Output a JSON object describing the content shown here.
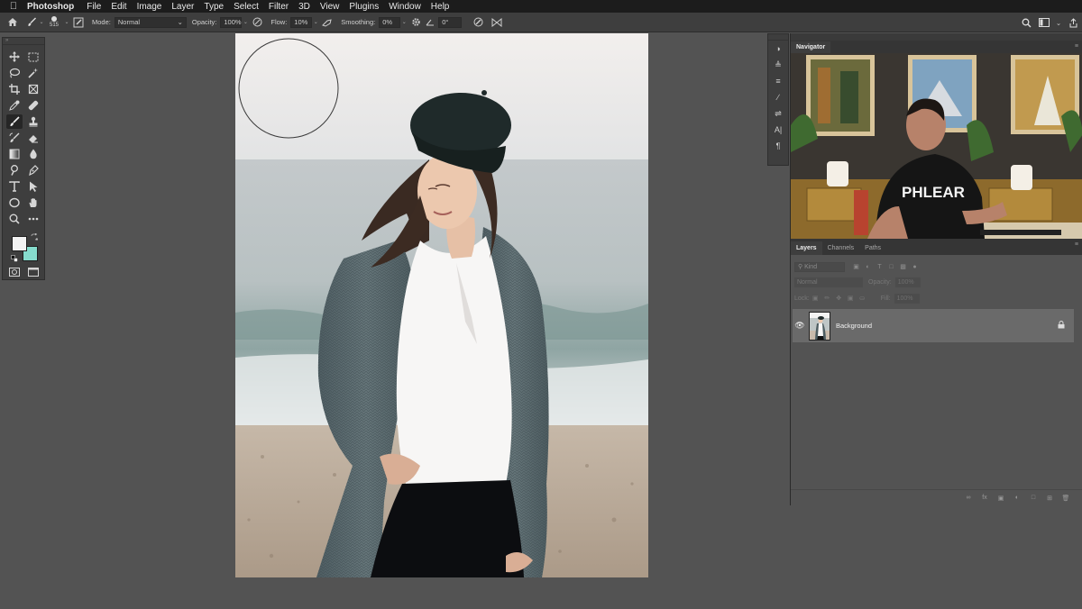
{
  "menubar": {
    "app_name": "Photoshop",
    "items": [
      "File",
      "Edit",
      "Image",
      "Layer",
      "Type",
      "Select",
      "Filter",
      "3D",
      "View",
      "Plugins",
      "Window",
      "Help"
    ]
  },
  "options": {
    "brush_size": "515",
    "mode_label": "Mode:",
    "mode_value": "Normal",
    "opacity_label": "Opacity:",
    "opacity_value": "100%",
    "flow_label": "Flow:",
    "flow_value": "10%",
    "smoothing_label": "Smoothing:",
    "smoothing_value": "0%",
    "angle_value": "0°"
  },
  "navigator": {
    "tab_label": "Navigator",
    "shirt_text": "PHLEAR"
  },
  "layers": {
    "tabs": [
      "Layers",
      "Channels",
      "Paths"
    ],
    "kind_placeholder": "Kind",
    "blend_mode": "Normal",
    "opacity_label": "Opacity:",
    "opacity_value": "100%",
    "lock_label": "Lock:",
    "fill_label": "Fill:",
    "fill_value": "100%",
    "layer_name": "Background"
  },
  "colors": {
    "foreground": "#f2f2f2",
    "background": "#86dccd",
    "ui_dark": "#3e3e3e",
    "workspace": "#535353",
    "selected_layer": "#6a6a6a"
  },
  "icons": {
    "toolbar": [
      "move-icon",
      "marquee-icon",
      "lasso-icon",
      "magic-wand-icon",
      "crop-icon",
      "frame-icon",
      "eyedropper-icon",
      "healing-icon",
      "brush-icon",
      "stamp-icon",
      "history-brush-icon",
      "eraser-icon",
      "gradient-icon",
      "blur-icon",
      "dodge-icon",
      "pen-icon",
      "type-icon",
      "path-select-icon",
      "ellipse-icon",
      "hand-icon",
      "zoom-icon",
      "more-icon"
    ]
  }
}
